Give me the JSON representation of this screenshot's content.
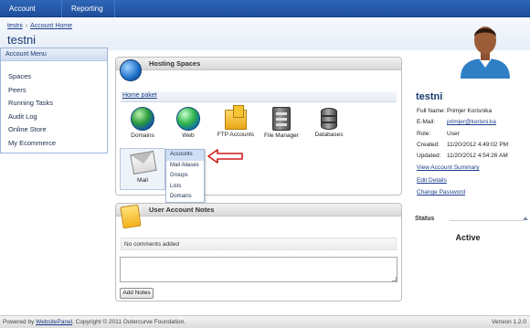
{
  "topnav": {
    "account_home": "Account Home",
    "reporting": "Reporting"
  },
  "breadcrumb": {
    "items": [
      "testni",
      "Account Home"
    ]
  },
  "page_title": "testni",
  "account_menu": {
    "title": "Account Menu",
    "items": [
      "Spaces",
      "Peers",
      "Running Tasks",
      "Audit Log",
      "Online Store",
      "My Ecommerce"
    ]
  },
  "hosting_spaces": {
    "title": "Hosting Spaces",
    "space_link": "Home paket",
    "icons": [
      {
        "label": "Domains",
        "icon": "globe-icon"
      },
      {
        "label": "Web",
        "icon": "web-globe-icon"
      },
      {
        "label": "FTP Accounts",
        "icon": "folder-icon"
      },
      {
        "label": "File Manager",
        "icon": "server-icon"
      },
      {
        "label": "Databases",
        "icon": "database-icon"
      }
    ],
    "mail": {
      "label": "Mail",
      "icon": "envelope-icon",
      "menu": [
        "Accounts",
        "Mail Aliases",
        "Groups",
        "Lists",
        "Domains"
      ],
      "active": "Accounts"
    }
  },
  "user_notes": {
    "title": "User Account Notes",
    "status": "No comments added",
    "textarea_value": "",
    "add_button": "Add Notes"
  },
  "account": {
    "name": "testni",
    "fields": [
      {
        "label": "Full Name:",
        "value": "Primjer Korisnika",
        "link": false
      },
      {
        "label": "E-Mail:",
        "value": "primjer@korisni.ka",
        "link": true
      },
      {
        "label": "Role:",
        "value": "User",
        "link": false
      },
      {
        "label": "Created:",
        "value": "11/20/2012 4:49:02 PM",
        "link": false
      },
      {
        "label": "Updated:",
        "value": "11/20/2012 4:54:26 AM",
        "link": false
      }
    ],
    "links": [
      "View Account Summary",
      "Edit Details",
      "Change Password"
    ]
  },
  "status": {
    "title": "Status",
    "value": "Active"
  },
  "footer": {
    "prefix": "Powered by ",
    "link": "WebsitePanel",
    "suffix": ". Copyright © 2011 Outercurve Foundation.",
    "version": "Version 1.2.0"
  },
  "colors": {
    "nav_blue": "#1f4e9c",
    "link_blue": "#1a3d8a",
    "title_blue": "#1b3a6f",
    "arrow_red": "#d11a1a"
  }
}
